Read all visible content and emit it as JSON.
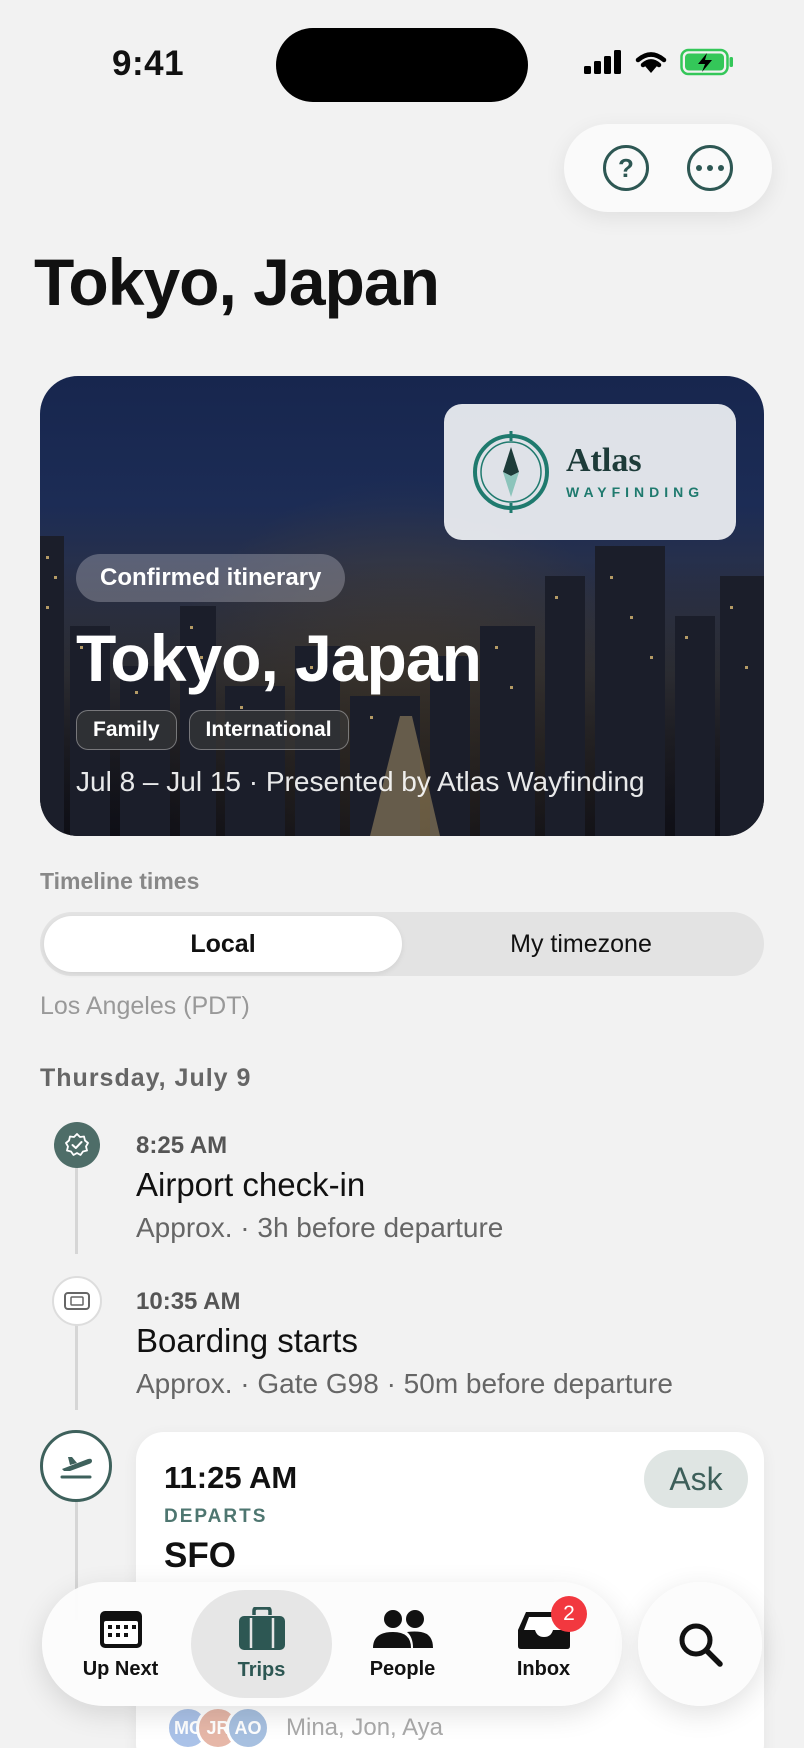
{
  "status": {
    "time": "9:41"
  },
  "header": {
    "title": "Tokyo, Japan",
    "help_glyph": "?"
  },
  "hero": {
    "badge": "Confirmed itinerary",
    "title": "Tokyo, Japan",
    "tags": [
      "Family",
      "International"
    ],
    "subtitle": "Jul 8 – Jul 15 · Presented by Atlas Wayfinding",
    "brand": {
      "name": "Atlas",
      "tagline": "WAYFINDING"
    }
  },
  "timeline_times": {
    "label": "Timeline times",
    "options": [
      "Local",
      "My timezone"
    ],
    "selected": "Local",
    "timezone_note": "Los Angeles (PDT)"
  },
  "day": {
    "label": "Thursday, July 9"
  },
  "events": [
    {
      "time": "8:25 AM",
      "title": "Airport check-in",
      "subtitle": "Approx. · 3h before departure",
      "icon": "check-badge-icon"
    },
    {
      "time": "10:35 AM",
      "title": "Boarding starts",
      "subtitle": "Approx. · Gate G98 · 50m before departure",
      "icon": "ticket-icon"
    }
  ],
  "flight": {
    "time": "11:25 AM",
    "label": "DEPARTS",
    "code": "SFO",
    "ask_label": "Ask",
    "icon": "plane-departure-icon",
    "travelers": {
      "initials": [
        "MC",
        "JR",
        "AO"
      ],
      "names": "Mina, Jon, Aya"
    }
  },
  "tabs": [
    {
      "label": "Up Next",
      "icon": "calendar-icon"
    },
    {
      "label": "Trips",
      "icon": "suitcase-icon",
      "active": true
    },
    {
      "label": "People",
      "icon": "people-icon"
    },
    {
      "label": "Inbox",
      "icon": "inbox-icon",
      "badge": "2"
    }
  ],
  "colors": {
    "accent": "#2d5753",
    "badge": "#f2383f",
    "battery": "#34c759"
  }
}
